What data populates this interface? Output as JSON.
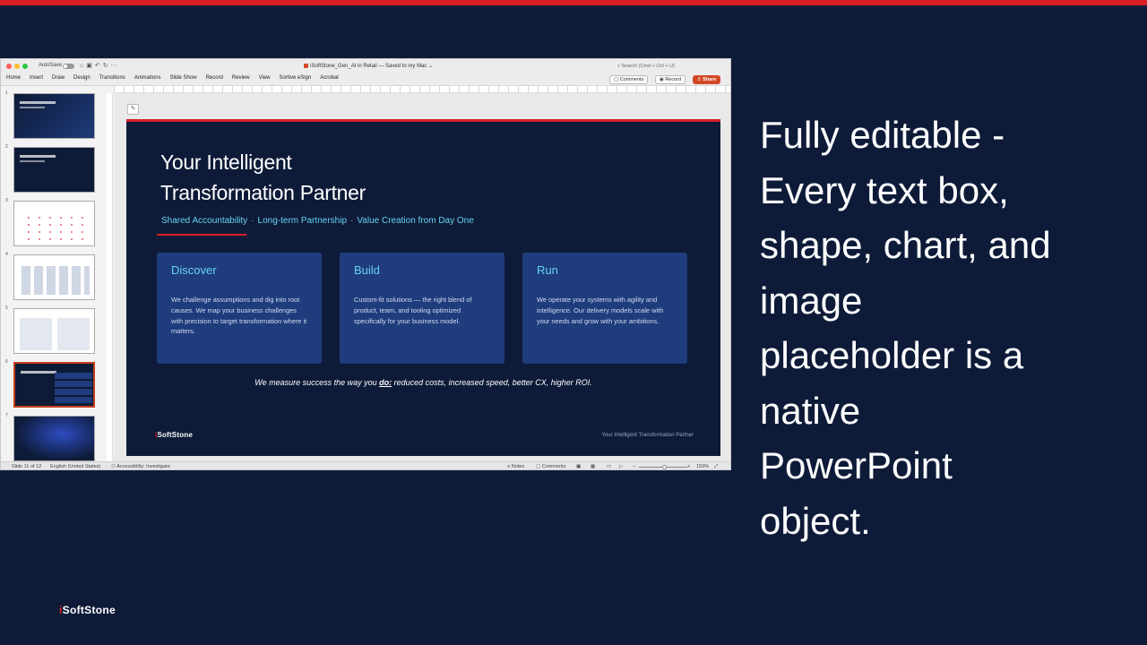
{
  "window": {
    "autosave_label": "AutoSave",
    "doc_title": "iSoftStone_Gen_AI in Retail — Saved to my Mac ⌄",
    "search_placeholder": "Search (Cmd + Ctrl + U)",
    "comments_label": "Comments",
    "record_label": "Record",
    "share_label": "Share",
    "tabs": [
      "Home",
      "Insert",
      "Draw",
      "Design",
      "Transitions",
      "Animations",
      "Slide Show",
      "Record",
      "Review",
      "View",
      "Sortive eSign",
      "Acrobat"
    ]
  },
  "thumbnails": [
    {
      "num": "1",
      "style": "dark"
    },
    {
      "num": "2",
      "style": "navy"
    },
    {
      "num": "3",
      "style": "light-map"
    },
    {
      "num": "4",
      "style": "light-grid"
    },
    {
      "num": "5",
      "style": "light-cards"
    },
    {
      "num": "6",
      "style": "navy-cards",
      "active": true
    },
    {
      "num": "7",
      "style": "glow"
    }
  ],
  "slide": {
    "title": "Your Intelligent\nTransformation Partner",
    "pillars": [
      "Shared Accountability",
      "Long-term Partnership",
      "Value Creation from Day One"
    ],
    "separator": "·",
    "cards": [
      {
        "title": "Discover",
        "body": "We challenge assumptions and dig into root causes. We map your business challenges with precision to target transformation where it matters."
      },
      {
        "title": "Build",
        "body": "Custom-fit solutions — the right blend of product, team, and tooling optimized specifically for your business model."
      },
      {
        "title": "Run",
        "body": "We operate your systems with agility and intelligence. Our delivery models scale with your needs and grow with your ambitions."
      }
    ],
    "tagline_pre": "We measure success the way you ",
    "tagline_em": "do:",
    "tagline_post": " reduced costs, increased speed, better CX, higher ROI.",
    "logo_i": "i",
    "logo_rest": "SoftStone",
    "footer": "Your Intelligent Transformation Partner"
  },
  "statusbar": {
    "slide_count": "Slide 11 of 12",
    "language": "English (United States)",
    "accessibility": "Accessibility: Investigate",
    "notes": "Notes",
    "comments": "Comments",
    "zoom": "150%"
  },
  "headline": "Fully editable -\nEvery text box,\nshape, chart, and\nimage\nplaceholder is a\nnative\nPowerPoint\nobject.",
  "brand": {
    "logo_i": "i",
    "logo_rest": "SoftStone",
    "accent": "#d81f26",
    "navy": "#0e1b38",
    "card_blue": "#1f3c7d",
    "cyan": "#66d3f0"
  }
}
